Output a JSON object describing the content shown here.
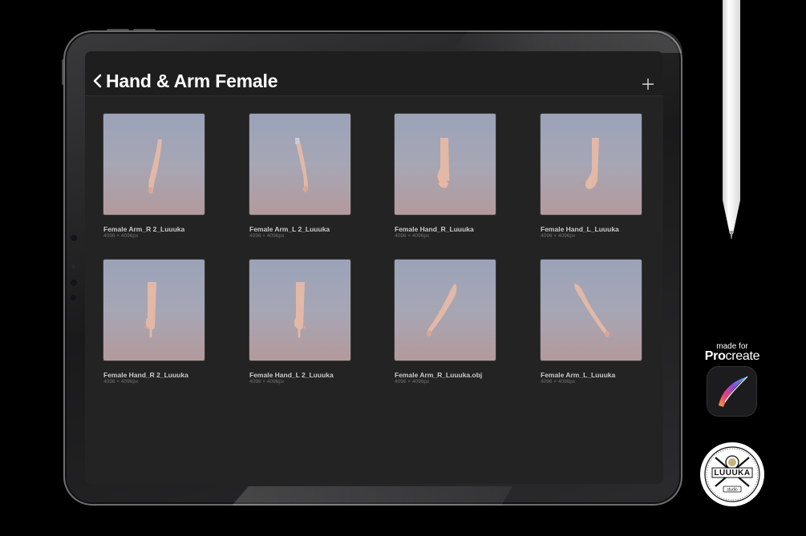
{
  "header": {
    "title": "Hand & Arm Female"
  },
  "files": [
    {
      "name": "Female Arm_R 2_Luuuka",
      "dimensions": "4096 × 4096px",
      "pose": "arm-hanging-right"
    },
    {
      "name": "Female Arm_L 2_Luuuka",
      "dimensions": "4096 × 4096px",
      "pose": "arm-hanging-left"
    },
    {
      "name": "Female Hand_R_Luuuka",
      "dimensions": "4096 × 4096px",
      "pose": "hand-open-right"
    },
    {
      "name": "Female Hand_L_Luuuka",
      "dimensions": "4096 × 4096px",
      "pose": "hand-open-left"
    },
    {
      "name": "Female Hand_R 2_Luuuka",
      "dimensions": "4096 × 4096px",
      "pose": "hand-pointing-right"
    },
    {
      "name": "Female Hand_L 2_Luuuka",
      "dimensions": "4096 × 4096px",
      "pose": "hand-pointing-left"
    },
    {
      "name": "Female Arm_R_Luuuka.obj",
      "dimensions": "4096 × 4096px",
      "pose": "arm-diagonal-right"
    },
    {
      "name": "Female Arm_L_Luuuka",
      "dimensions": "4096 × 4096px",
      "pose": "arm-diagonal-left"
    }
  ],
  "badge": {
    "made_for": "made for",
    "brand_prefix": "Pro",
    "brand_suffix": "create",
    "seal_text": "LUUUKA",
    "seal_subtext": "studio"
  },
  "icons": {
    "back": "chevron-left-icon",
    "add": "plus-icon",
    "app": "procreate-app-icon"
  },
  "colors": {
    "background": "#000000",
    "screen": "#232323",
    "thumbnail_top": "#9ba3b8",
    "thumbnail_bottom": "#b39a9c",
    "skin": "#e2b8a6"
  }
}
